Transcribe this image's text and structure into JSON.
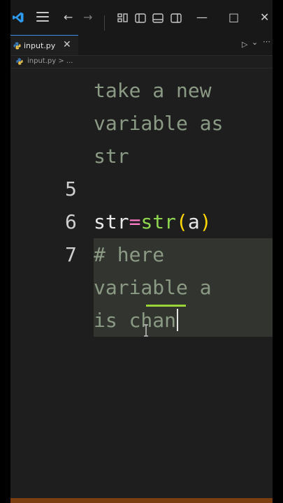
{
  "titlebar": {
    "app_icon": "vscode-logo-icon",
    "menu_icon": "hamburger-icon",
    "back_glyph": "←",
    "forward_glyph": "→",
    "minimize_glyph": "—",
    "maximize_glyph": "□",
    "close_glyph": "✕"
  },
  "tab": {
    "label": "input.py",
    "close_glyph": "✕",
    "run_glyph": "▷",
    "run_menu_glyph": "⌄"
  },
  "breadcrumb": {
    "text": "input.py > ..."
  },
  "editor": {
    "lines": [
      {
        "number": "",
        "text": "take a new"
      },
      {
        "number": "",
        "text": "variable as"
      },
      {
        "number": "",
        "text": "str"
      },
      {
        "number": "5",
        "text": ""
      },
      {
        "number": "6",
        "text": "str=str(a)"
      },
      {
        "number": "7",
        "text": "# here"
      },
      {
        "number": "",
        "text": "variable a"
      },
      {
        "number": "",
        "text": "is chan"
      }
    ],
    "code6": {
      "part1": "str",
      "part2": "=",
      "part3": "str",
      "part4": "(",
      "part5": "a",
      "part6": ")"
    }
  },
  "colors": {
    "accent": "#3a8ee6",
    "status": "#7a3e10"
  }
}
